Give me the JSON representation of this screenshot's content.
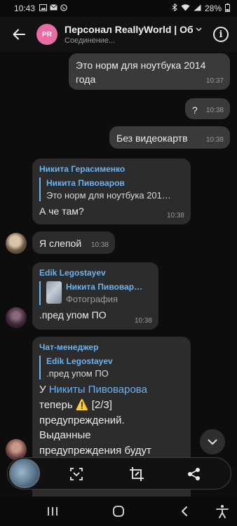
{
  "status_bar": {
    "time": "10:43",
    "battery": "28%",
    "icons": [
      "image-notification-icon",
      "mail-icon",
      "viber-icon",
      "bluetooth-icon",
      "wifi-icon",
      "signal-icon",
      "battery-icon"
    ]
  },
  "header": {
    "avatar_initials": "PR",
    "avatar_color": "#e86da5",
    "title": "Персонал ReallyWorld | Об…",
    "subtitle": "Соединение..."
  },
  "messages": [
    {
      "id": "m1",
      "direction": "out",
      "text": "Это норм для ноутбука 2014 года",
      "time": "10:37"
    },
    {
      "id": "m2",
      "direction": "out",
      "text": "?",
      "time": "10:38"
    },
    {
      "id": "m3",
      "direction": "out",
      "text": "Без видеокартв",
      "time": "10:38"
    },
    {
      "id": "m4",
      "direction": "in",
      "sender": "Никита Герасименко",
      "reply_to": "Никита Пивоваров",
      "reply_text": "Это норм для ноутбука 201…",
      "text": "А че там?",
      "time": "10:38"
    },
    {
      "id": "m5",
      "direction": "in",
      "text": "Я слепой",
      "time": "10:38"
    },
    {
      "id": "m6",
      "direction": "in",
      "sender": "Edik Legostayev",
      "reply_to": "Никита Пивовар…",
      "reply_text": "Фотография",
      "text": ".пред упом ПО",
      "time": "10:38"
    },
    {
      "id": "m7",
      "direction": "in",
      "sender": "Чат-менеджер",
      "reply_to": "Edik Legostayev",
      "reply_text": ".пред упом ПО",
      "text_prefix": "У ",
      "mention": "Никиты Пивоварова",
      "line2_prefix": "теперь ",
      "warn_icon": "⚠️",
      "line2_suffix": " [2/3]",
      "line3": "предупреждений.",
      "line4": "Выданные",
      "line5": "предупреждения будут"
    }
  ],
  "colors": {
    "accent": "#6cb3ef",
    "incoming_bubble": "#2c2c2c",
    "outgoing_bubble": "#3a3a3a",
    "background": "#0d0d0d"
  },
  "toolbar": {
    "icons": [
      "screenshot-thumbnail",
      "scroll-capture-icon",
      "crop-edit-icon",
      "share-icon"
    ]
  },
  "navbar": {
    "icons": [
      "recent-apps-icon",
      "home-icon",
      "back-icon",
      "accessibility-icon"
    ]
  }
}
